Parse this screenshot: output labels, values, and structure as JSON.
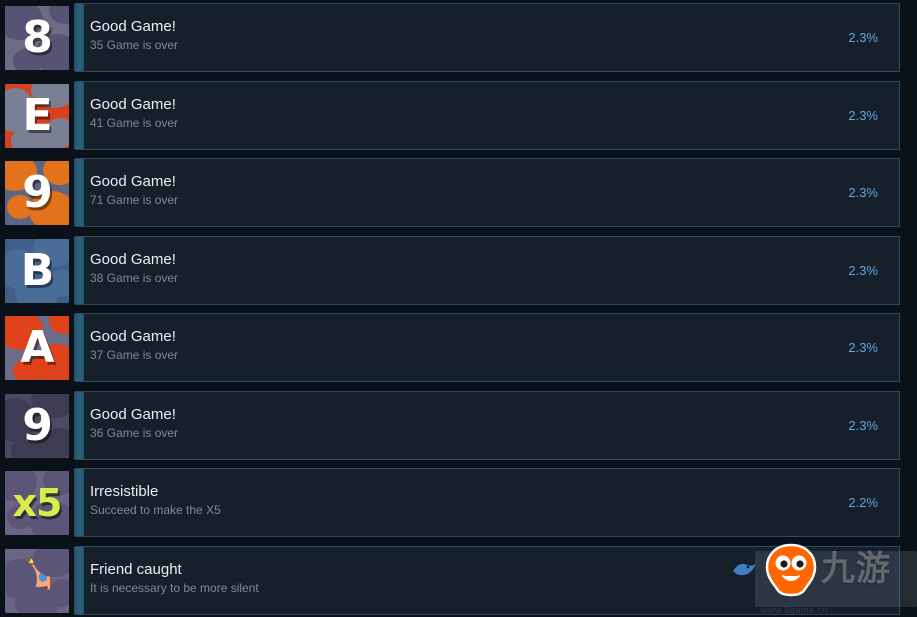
{
  "list": {
    "name": "steam-achievement-list",
    "background_color": "#0b1118",
    "panel_color": "#16202b",
    "panel_border_color": "#2c4a60",
    "accent_bar_color": "#2c6281",
    "title_color": "#e9eef2",
    "desc_color": "#7e8a93",
    "percent_color": "#61a6dc",
    "rows": [
      {
        "title": "Good Game!",
        "desc": "35 Game is over",
        "percent": "2.3%",
        "icon_name": "achievement-icon-8",
        "icon_glyph": "8",
        "icon_bg": "#6d6b86",
        "icon_blob": "#565472",
        "icon_fg": "#ffffff"
      },
      {
        "title": "Good Game!",
        "desc": "41 Game is over",
        "percent": "2.3%",
        "icon_name": "achievement-icon-e",
        "icon_glyph": "E",
        "icon_bg": "#d8401f",
        "icon_blob": "#7b7f94",
        "icon_fg": "#ffffff"
      },
      {
        "title": "Good Game!",
        "desc": "71 Game is over",
        "percent": "2.3%",
        "icon_name": "achievement-icon-9-orange",
        "icon_glyph": "9",
        "icon_bg": "#5d6484",
        "icon_blob": "#e2731c",
        "icon_fg": "#ffffff"
      },
      {
        "title": "Good Game!",
        "desc": "38 Game is over",
        "percent": "2.3%",
        "icon_name": "achievement-icon-b",
        "icon_glyph": "B",
        "icon_bg": "#3f5f88",
        "icon_blob": "#4a6d98",
        "icon_fg": "#ffffff"
      },
      {
        "title": "Good Game!",
        "desc": "37 Game is over",
        "percent": "2.3%",
        "icon_name": "achievement-icon-a",
        "icon_glyph": "A",
        "icon_bg": "#6b6d8a",
        "icon_blob": "#e0431c",
        "icon_fg": "#ffffff"
      },
      {
        "title": "Good Game!",
        "desc": "36 Game is over",
        "percent": "2.3%",
        "icon_name": "achievement-icon-9-purple",
        "icon_glyph": "9",
        "icon_bg": "#4b4a60",
        "icon_blob": "#3d3c52",
        "icon_fg": "#ffffff"
      },
      {
        "title": "Irresistible",
        "desc": "Succeed to make the X5",
        "percent": "2.2%",
        "icon_name": "achievement-icon-x5",
        "icon_glyph": "x5",
        "icon_bg": "#6a6487",
        "icon_blob": "#5b5577",
        "icon_fg": "#d6ed4a"
      },
      {
        "title": "Friend caught",
        "desc": "It is necessary to be more silent",
        "percent": "",
        "icon_name": "achievement-icon-face",
        "icon_glyph": "face",
        "icon_bg": "#6a6487",
        "icon_blob": "#5b5577",
        "icon_fg": "#f0a87c"
      }
    ]
  },
  "watermark": {
    "text": "九游",
    "subtext": "www.9game.cn",
    "mascot_color": "#ff6600",
    "text_color": "#ffffff"
  }
}
